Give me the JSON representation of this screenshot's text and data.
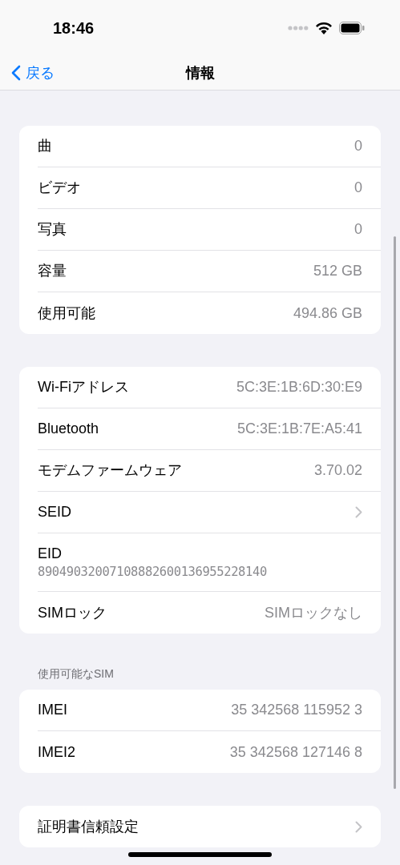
{
  "status_bar": {
    "time": "18:46"
  },
  "nav": {
    "back": "戻る",
    "title": "情報"
  },
  "groups": [
    {
      "rows": [
        {
          "kind": "value",
          "label": "曲",
          "value": "0"
        },
        {
          "kind": "value",
          "label": "ビデオ",
          "value": "0"
        },
        {
          "kind": "value",
          "label": "写真",
          "value": "0"
        },
        {
          "kind": "value",
          "label": "容量",
          "value": "512 GB"
        },
        {
          "kind": "value",
          "label": "使用可能",
          "value": "494.86 GB"
        }
      ]
    },
    {
      "rows": [
        {
          "kind": "value",
          "label": "Wi-Fiアドレス",
          "value": "5C:3E:1B:6D:30:E9"
        },
        {
          "kind": "value",
          "label": "Bluetooth",
          "value": "5C:3E:1B:7E:A5:41"
        },
        {
          "kind": "value",
          "label": "モデムファームウェア",
          "value": "3.70.02"
        },
        {
          "kind": "chevron",
          "label": "SEID"
        },
        {
          "kind": "stacked",
          "label": "EID",
          "value": "89049032007108882600136955228140"
        },
        {
          "kind": "value",
          "label": "SIMロック",
          "value": "SIMロックなし"
        }
      ]
    },
    {
      "header": "使用可能なSIM",
      "rows": [
        {
          "kind": "value",
          "label": "IMEI",
          "value": "35 342568 115952 3"
        },
        {
          "kind": "value",
          "label": "IMEI2",
          "value": "35 342568 127146 8"
        }
      ]
    },
    {
      "rows": [
        {
          "kind": "chevron",
          "label": "証明書信頼設定"
        }
      ]
    }
  ]
}
